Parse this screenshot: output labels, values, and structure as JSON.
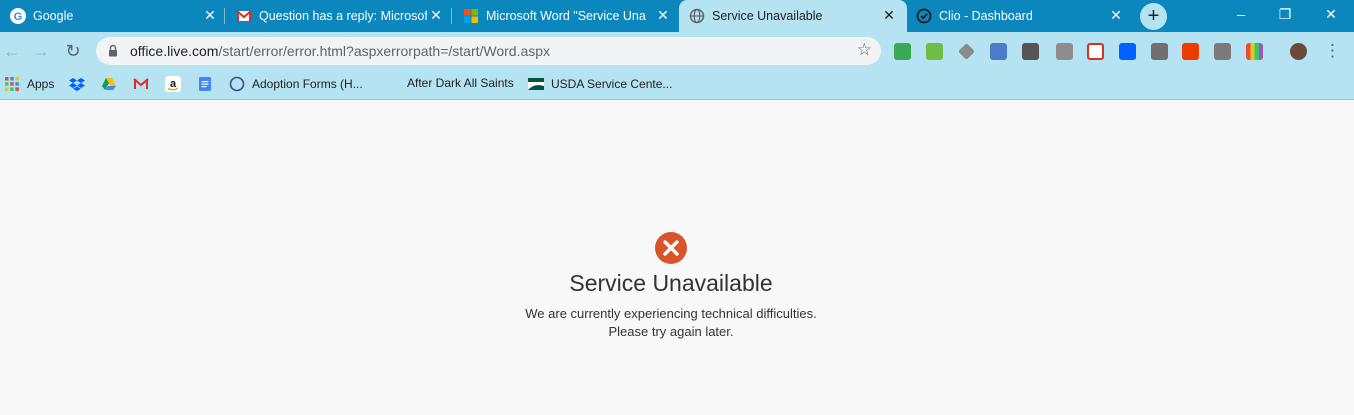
{
  "colors": {
    "tabstrip": "#0b87be",
    "toolbar": "#b5e3f2",
    "page_bg": "#f8f8f8",
    "error_red": "#d9542b"
  },
  "tabs": [
    {
      "title": "Google",
      "icon": "google-icon",
      "close": "✕"
    },
    {
      "title": "Question has a reply: Microsoft",
      "icon": "gmail-icon",
      "close": "✕"
    },
    {
      "title": "Microsoft Word \"Service Unav...",
      "icon": "microsoft-icon",
      "close": "✕"
    },
    {
      "title": "Service Unavailable",
      "icon": "globe-icon",
      "close": "✕",
      "active": true
    },
    {
      "title": "Clio - Dashboard",
      "icon": "clio-icon",
      "close": "✕"
    }
  ],
  "newtab": "+",
  "window_controls": {
    "minimize": "–",
    "maximize": "❐",
    "close": "✕"
  },
  "toolbar": {
    "back": "←",
    "forward": "→",
    "reload": "↻",
    "url_host": "office.live.com",
    "url_path": "/start/error/error.html?aspxerrorpath=/start/Word.aspx",
    "star": "☆",
    "menu": "⋮"
  },
  "bookmarks": [
    {
      "label": "Apps",
      "icon": "apps-grid-icon"
    },
    {
      "label": "",
      "icon": "dropbox-icon"
    },
    {
      "label": "",
      "icon": "drive-icon"
    },
    {
      "label": "",
      "icon": "gmail-icon"
    },
    {
      "label": "",
      "icon": "amazon-icon"
    },
    {
      "label": "",
      "icon": "docs-icon"
    },
    {
      "label": "Adoption Forms (H...",
      "icon": "circle-icon"
    },
    {
      "label": "After Dark All Saints",
      "icon": ""
    },
    {
      "label": "USDA Service Cente...",
      "icon": "usda-icon"
    }
  ],
  "error": {
    "title": "Service Unavailable",
    "line1": "We are currently experiencing technical difficulties.",
    "line2": "Please try again later."
  }
}
